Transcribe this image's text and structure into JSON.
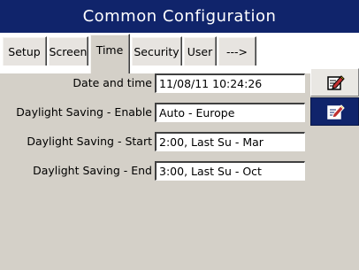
{
  "window": {
    "title": "Common Configuration"
  },
  "tabs": [
    {
      "label": "Setup",
      "active": false
    },
    {
      "label": "Screen",
      "active": false
    },
    {
      "label": "Time",
      "active": true
    },
    {
      "label": "Security",
      "active": false
    },
    {
      "label": "User",
      "active": false
    },
    {
      "label": "--->",
      "active": false
    }
  ],
  "settings": [
    {
      "label": "Date and time",
      "value": "11/08/11 10:24:26",
      "edit_icon": "edit-icon"
    },
    {
      "label": "Daylight Saving - Enable",
      "value": "Auto - Europe",
      "edit_icon": "edit-icon"
    },
    {
      "label": "Daylight Saving - Start",
      "value": "2:00, Last Su - Mar"
    },
    {
      "label": "Daylight Saving - End",
      "value": "3:00, Last Su - Oct"
    }
  ],
  "colors": {
    "title_bar": "#10246b",
    "panel_bg": "#d4d0c8",
    "tab_strip_bg": "#ffffff",
    "field_bg": "#ffffff",
    "selected_button": "#10246b"
  }
}
